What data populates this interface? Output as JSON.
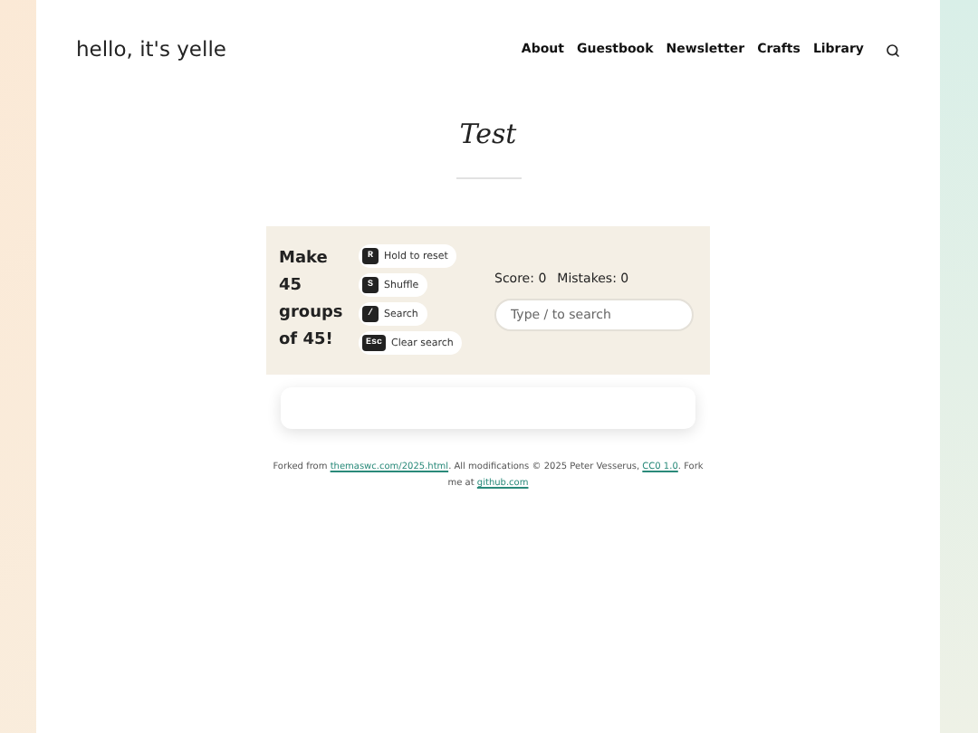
{
  "site_title": "hello, it's yelle",
  "nav": [
    {
      "label": "About"
    },
    {
      "label": "Guestbook"
    },
    {
      "label": "Newsletter"
    },
    {
      "label": "Crafts"
    },
    {
      "label": "Library"
    }
  ],
  "page_title": "Test",
  "game": {
    "heading": "Make 45 groups of 45!",
    "shortcuts": [
      {
        "key": "R",
        "label": "Hold to reset"
      },
      {
        "key": "S",
        "label": "Shuffle"
      },
      {
        "key": "/",
        "label": "Search"
      },
      {
        "key": "Esc",
        "label": "Clear search"
      }
    ],
    "score": "Score: 0",
    "mistakes": "Mistakes: 0",
    "search": {
      "placeholder": "Type / to search"
    }
  },
  "footer": [
    {
      "kind": "text",
      "text": "Forked from "
    },
    {
      "kind": "link",
      "text": "themaswc.com/2025.html"
    },
    {
      "kind": "text",
      "text": ". All modifications © 2025 Peter Vesserus, "
    },
    {
      "kind": "link",
      "text": "CC0 1.0"
    },
    {
      "kind": "text",
      "text": ". Fork me at "
    },
    {
      "kind": "link",
      "text": "github.com"
    }
  ]
}
